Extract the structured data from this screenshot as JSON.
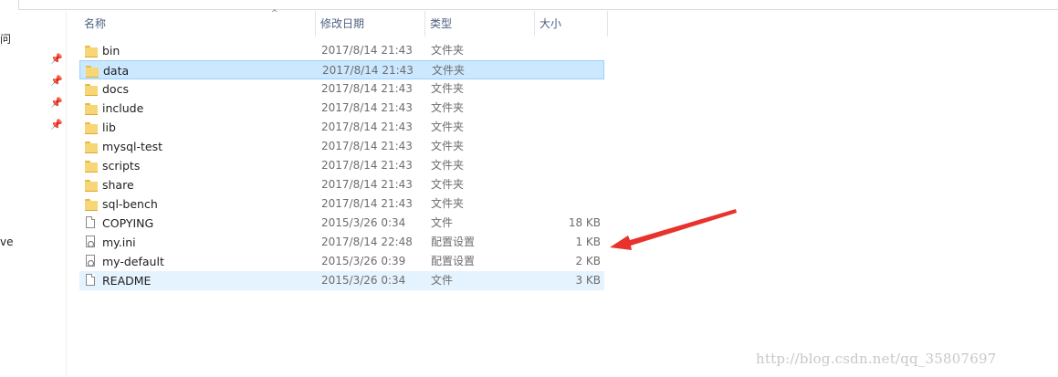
{
  "sidebar": {
    "items": [
      {
        "label": "问"
      },
      {
        "label": "ve"
      }
    ]
  },
  "columns": {
    "name": "名称",
    "date": "修改日期",
    "type": "类型",
    "size": "大小"
  },
  "files": [
    {
      "name": "bin",
      "date": "2017/8/14 21:43",
      "type": "文件夹",
      "size": "",
      "icon": "folder-icon"
    },
    {
      "name": "data",
      "date": "2017/8/14 21:43",
      "type": "文件夹",
      "size": "",
      "icon": "folder-icon",
      "state": "selected"
    },
    {
      "name": "docs",
      "date": "2017/8/14 21:43",
      "type": "文件夹",
      "size": "",
      "icon": "folder-icon"
    },
    {
      "name": "include",
      "date": "2017/8/14 21:43",
      "type": "文件夹",
      "size": "",
      "icon": "folder-icon"
    },
    {
      "name": "lib",
      "date": "2017/8/14 21:43",
      "type": "文件夹",
      "size": "",
      "icon": "folder-icon"
    },
    {
      "name": "mysql-test",
      "date": "2017/8/14 21:43",
      "type": "文件夹",
      "size": "",
      "icon": "folder-icon"
    },
    {
      "name": "scripts",
      "date": "2017/8/14 21:43",
      "type": "文件夹",
      "size": "",
      "icon": "folder-icon"
    },
    {
      "name": "share",
      "date": "2017/8/14 21:43",
      "type": "文件夹",
      "size": "",
      "icon": "folder-icon"
    },
    {
      "name": "sql-bench",
      "date": "2017/8/14 21:43",
      "type": "文件夹",
      "size": "",
      "icon": "folder-icon"
    },
    {
      "name": "COPYING",
      "date": "2015/3/26 0:34",
      "type": "文件",
      "size": "18 KB",
      "icon": "document-icon"
    },
    {
      "name": "my.ini",
      "date": "2017/8/14 22:48",
      "type": "配置设置",
      "size": "1 KB",
      "icon": "config-file-icon"
    },
    {
      "name": "my-default",
      "date": "2015/3/26 0:39",
      "type": "配置设置",
      "size": "2 KB",
      "icon": "config-file-icon"
    },
    {
      "name": "README",
      "date": "2015/3/26 0:34",
      "type": "文件",
      "size": "3 KB",
      "icon": "document-icon",
      "state": "hover"
    }
  ],
  "annotation": {
    "arrow_color": "#e8322b",
    "icon": "red-arrow-annotation"
  },
  "watermark": "http://blog.csdn.net/qq_35807697"
}
